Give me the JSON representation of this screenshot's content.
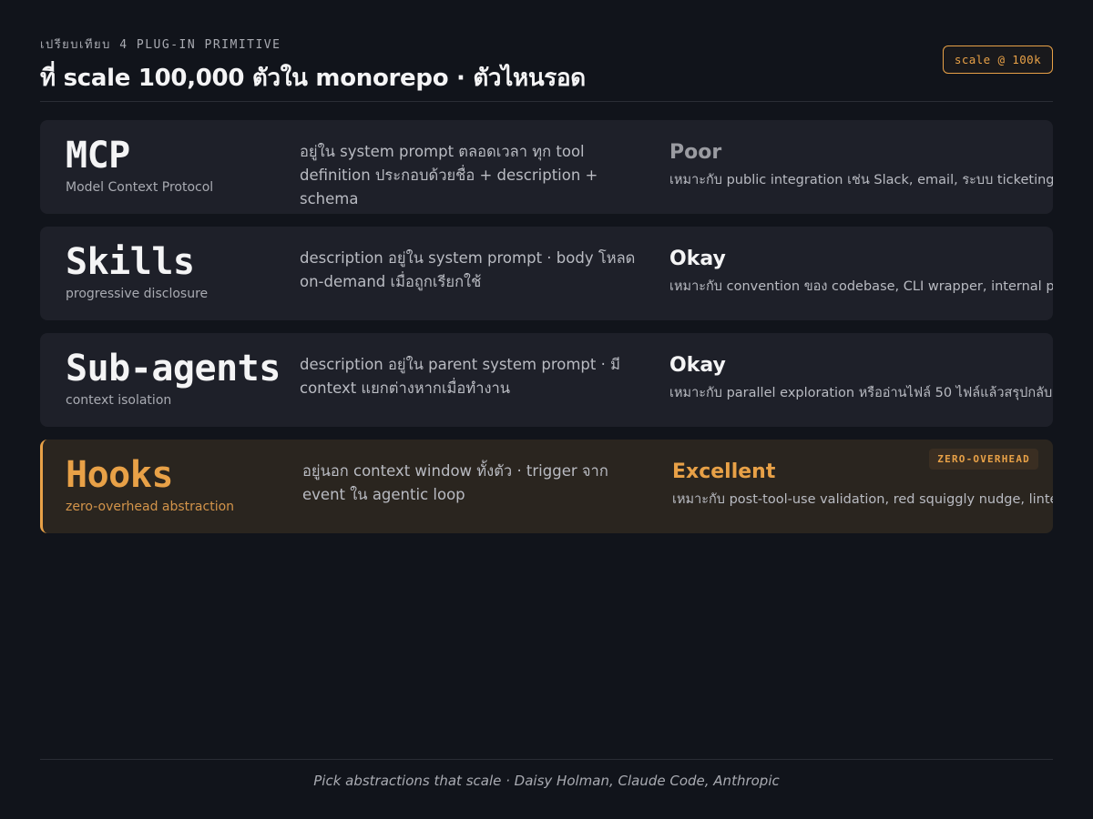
{
  "header": {
    "eyebrow": "เปรียบเทียบ 4 PLUG-IN PRIMITIVE",
    "title": "ที่ scale 100,000 ตัวใน monorepo · ตัวไหนรอด",
    "scale_pill": "scale @ 100k"
  },
  "rows": [
    {
      "name": "MCP",
      "subtitle": "Model Context Protocol",
      "description": "อยู่ใน system prompt ตลอดเวลา ทุก tool definition ประกอบด้วยชื่อ + description + schema",
      "verdict": "Poor",
      "fit": "เหมาะกับ public integration เช่น Slack, email, ระบบ ticketing"
    },
    {
      "name": "Skills",
      "subtitle": "progressive disclosure",
      "description": "description อยู่ใน system prompt · body โหลด on-demand เมื่อถูกเรียกใช้",
      "verdict": "Okay",
      "fit": "เหมาะกับ convention ของ codebase, CLI wrapper, internal pattern"
    },
    {
      "name": "Sub-agents",
      "subtitle": "context isolation",
      "description": "description อยู่ใน parent system prompt · มี context แยกต่างหากเมื่อทำงาน",
      "verdict": "Okay",
      "fit": "เหมาะกับ parallel exploration หรืออ่านไฟล์ 50 ไฟล์แล้วสรุปกลับมา"
    },
    {
      "name": "Hooks",
      "subtitle": "zero-overhead abstraction",
      "description": "อยู่นอก context window ทั้งตัว · trigger จาก event ใน agentic loop",
      "verdict": "Excellent",
      "fit": "เหมาะกับ post-tool-use validation, red squiggly nudge, linter",
      "badge": "ZERO-OVERHEAD"
    }
  ],
  "colors": {
    "background": "#11141b",
    "card": "#1e2029",
    "highlight_card": "#2a251f",
    "accent": "#e8a147"
  },
  "footer": {
    "caption": "Pick abstractions that scale · Daisy Holman, Claude Code, Anthropic"
  }
}
